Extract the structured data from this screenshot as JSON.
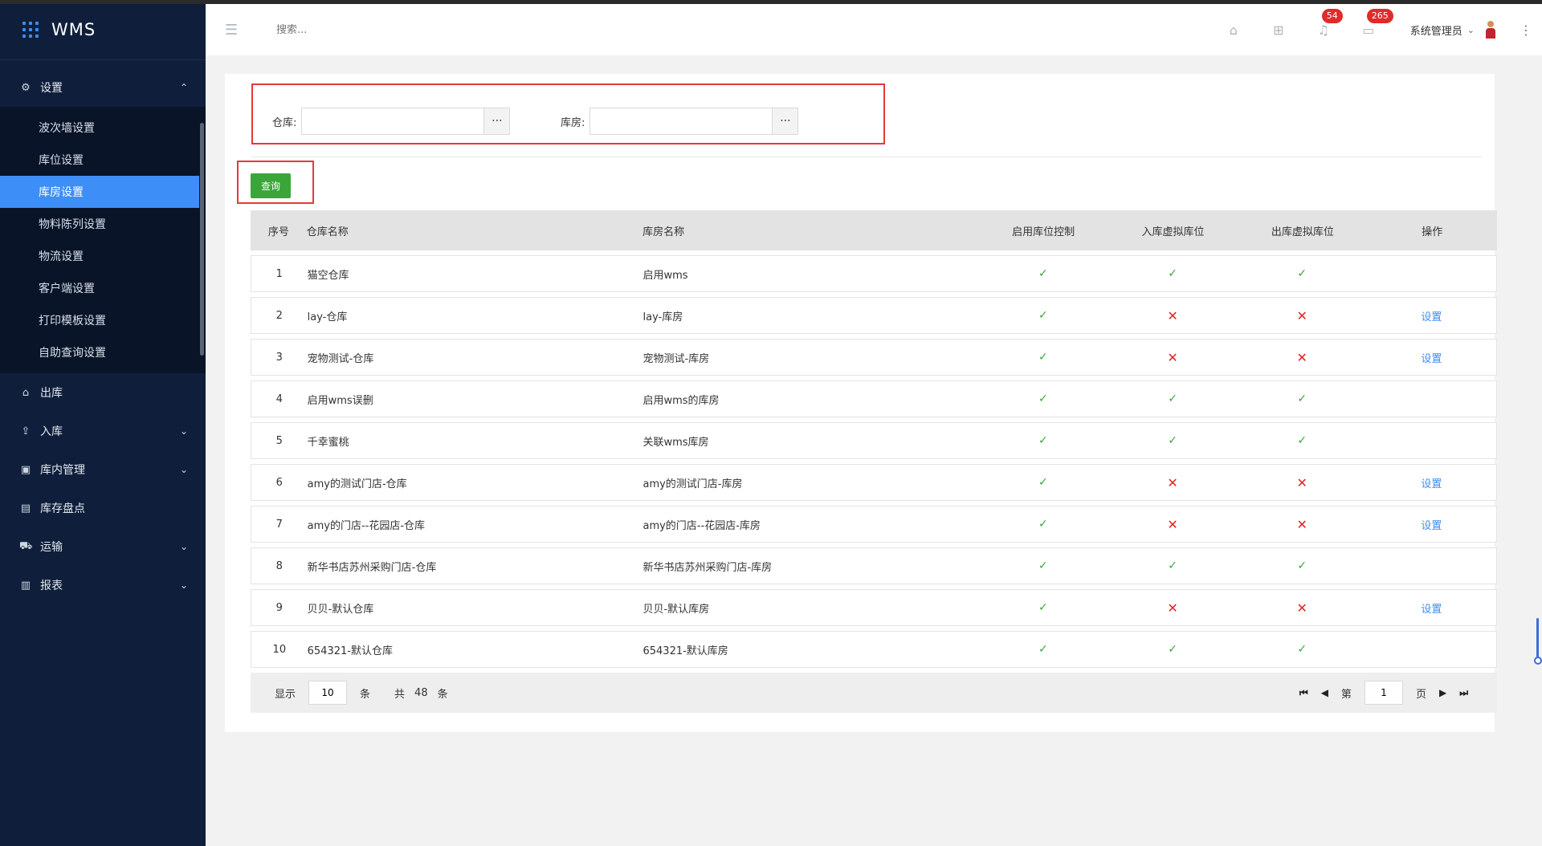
{
  "app": {
    "title": "WMS"
  },
  "sidebar": {
    "settings": {
      "label": "设置",
      "children": [
        "波次墙设置",
        "库位设置",
        "库房设置",
        "物料陈列设置",
        "物流设置",
        "客户端设置",
        "打印模板设置",
        "自助查询设置"
      ],
      "active": "库房设置"
    },
    "items": [
      {
        "label": "出库",
        "icon": "home-icon",
        "has_children": false
      },
      {
        "label": "入库",
        "icon": "inbound-icon",
        "has_children": true
      },
      {
        "label": "库内管理",
        "icon": "briefcase-icon",
        "has_children": true
      },
      {
        "label": "库存盘点",
        "icon": "clipboard-icon",
        "has_children": false
      },
      {
        "label": "运输",
        "icon": "truck-icon",
        "has_children": true
      },
      {
        "label": "报表",
        "icon": "bar-chart-icon",
        "has_children": true
      }
    ]
  },
  "header": {
    "search_placeholder": "搜索...",
    "notifications_badge": "54",
    "messages_badge": "265",
    "user_name": "系统管理员"
  },
  "filters": {
    "warehouse_label": "仓库:",
    "room_label": "库房:",
    "picker_symbol": "···"
  },
  "query_button": "查询",
  "table": {
    "headers": [
      "序号",
      "仓库名称",
      "库房名称",
      "启用库位控制",
      "入库虚拟库位",
      "出库虚拟库位",
      "操作"
    ],
    "rows": [
      {
        "idx": "1",
        "warehouse": "猫空仓库",
        "room": "启用wms",
        "loc_ctrl": "✓",
        "in_virtual": "✓",
        "out_virtual": "✓",
        "action": ""
      },
      {
        "idx": "2",
        "warehouse": "lay-仓库",
        "room": "lay-库房",
        "loc_ctrl": "✓",
        "in_virtual": "✕",
        "out_virtual": "✕",
        "action": "设置"
      },
      {
        "idx": "3",
        "warehouse": "宠物测试-仓库",
        "room": "宠物测试-库房",
        "loc_ctrl": "✓",
        "in_virtual": "✕",
        "out_virtual": "✕",
        "action": "设置"
      },
      {
        "idx": "4",
        "warehouse": "启用wms误删",
        "room": "启用wms的库房",
        "loc_ctrl": "✓",
        "in_virtual": "✓",
        "out_virtual": "✓",
        "action": ""
      },
      {
        "idx": "5",
        "warehouse": "千幸蜜桃",
        "room": "关联wms库房",
        "loc_ctrl": "✓",
        "in_virtual": "✓",
        "out_virtual": "✓",
        "action": ""
      },
      {
        "idx": "6",
        "warehouse": "amy的测试门店-仓库",
        "room": "amy的测试门店-库房",
        "loc_ctrl": "✓",
        "in_virtual": "✕",
        "out_virtual": "✕",
        "action": "设置"
      },
      {
        "idx": "7",
        "warehouse": "amy的门店--花园店-仓库",
        "room": "amy的门店--花园店-库房",
        "loc_ctrl": "✓",
        "in_virtual": "✕",
        "out_virtual": "✕",
        "action": "设置"
      },
      {
        "idx": "8",
        "warehouse": "新华书店苏州采购门店-仓库",
        "room": "新华书店苏州采购门店-库房",
        "loc_ctrl": "✓",
        "in_virtual": "✓",
        "out_virtual": "✓",
        "action": ""
      },
      {
        "idx": "9",
        "warehouse": "贝贝-默认仓库",
        "room": "贝贝-默认库房",
        "loc_ctrl": "✓",
        "in_virtual": "✕",
        "out_virtual": "✕",
        "action": "设置"
      },
      {
        "idx": "10",
        "warehouse": "654321-默认仓库",
        "room": "654321-默认库房",
        "loc_ctrl": "✓",
        "in_virtual": "✓",
        "out_virtual": "✓",
        "action": ""
      }
    ]
  },
  "pager": {
    "show_label": "显示",
    "page_size": "10",
    "unit": "条",
    "total_label": "共",
    "total": "48",
    "page_prefix": "第",
    "current_page": "1",
    "page_suffix": "页"
  },
  "colors": {
    "sidebar_bg": "#0f1f3b",
    "active_blue": "#3e8ef7",
    "ok_green": "#3aa63a",
    "error_red": "#e02525",
    "highlight_red": "#e23b3b"
  }
}
